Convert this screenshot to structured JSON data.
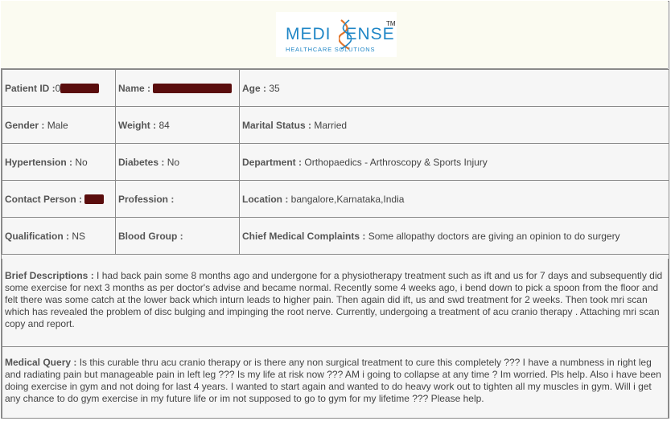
{
  "logo": {
    "brand_left": "MEDI",
    "brand_right": "ENSE",
    "tagline": "HEALTHCARE SOLUTIONS",
    "tm": "TM",
    "icon": "dna-helix-icon",
    "color": "#1f86c6"
  },
  "rows": [
    [
      {
        "label": "Patient ID :",
        "value": "0",
        "redacted": true
      },
      {
        "label": "Name :",
        "value": "",
        "redacted": true
      },
      {
        "label": "Age :",
        "value": "35"
      }
    ],
    [
      {
        "label": "Gender :",
        "value": "Male"
      },
      {
        "label": "Weight :",
        "value": "84"
      },
      {
        "label": "Marital Status :",
        "value": "Married"
      }
    ],
    [
      {
        "label": "Hypertension :",
        "value": "No"
      },
      {
        "label": "Diabetes :",
        "value": "No"
      },
      {
        "label": "Department :",
        "value": "Orthopaedics - Arthroscopy & Sports Injury"
      }
    ],
    [
      {
        "label": "Contact Person :",
        "value": "",
        "redacted": true
      },
      {
        "label": "Profession :",
        "value": ""
      },
      {
        "label": "Location :",
        "value": "bangalore,Karnataka,India"
      }
    ],
    [
      {
        "label": "Qualification :",
        "value": "NS"
      },
      {
        "label": "Blood Group :",
        "value": ""
      },
      {
        "label": "Chief Medical Complaints :",
        "value": "Some allopathy doctors are giving an opinion to do surgery"
      }
    ]
  ],
  "brief": {
    "label": "Brief Descriptions :",
    "text": "I had back pain some 8 months ago and undergone for a physiotherapy treatment such as ift and us for 7 days and subsequently did some exercise for next 3 months as per doctor's advise and became normal. Recently some 4 weeks ago, i bend down to pick a spoon from the floor and felt there was some catch at the lower back which inturn leads to higher pain. Then again did ift, us and swd treatment for 2 weeks. Then took mri scan which has revealed the problem of disc bulging and impinging the root nerve. Currently, undergoing a treatment of acu cranio therapy . Attaching mri scan copy and report."
  },
  "query": {
    "label": "Medical Query :",
    "text": "Is this curable thru acu cranio therapy or is there any non surgical treatment to cure this completely ??? I have a numbness in right leg and radiating pain but manageable pain in left leg ??? Is my life at risk now ??? AM i going to collapse at any time ? Im worried. Pls help. Also i have been doing exercise in gym and not doing for last 4 years. I wanted to start again and wanted to do heavy work out to tighten all my muscles in gym. Will i get any chance to do gym exercise in my future life or im not supposed to go to gym for my lifetime ??? Please help."
  }
}
